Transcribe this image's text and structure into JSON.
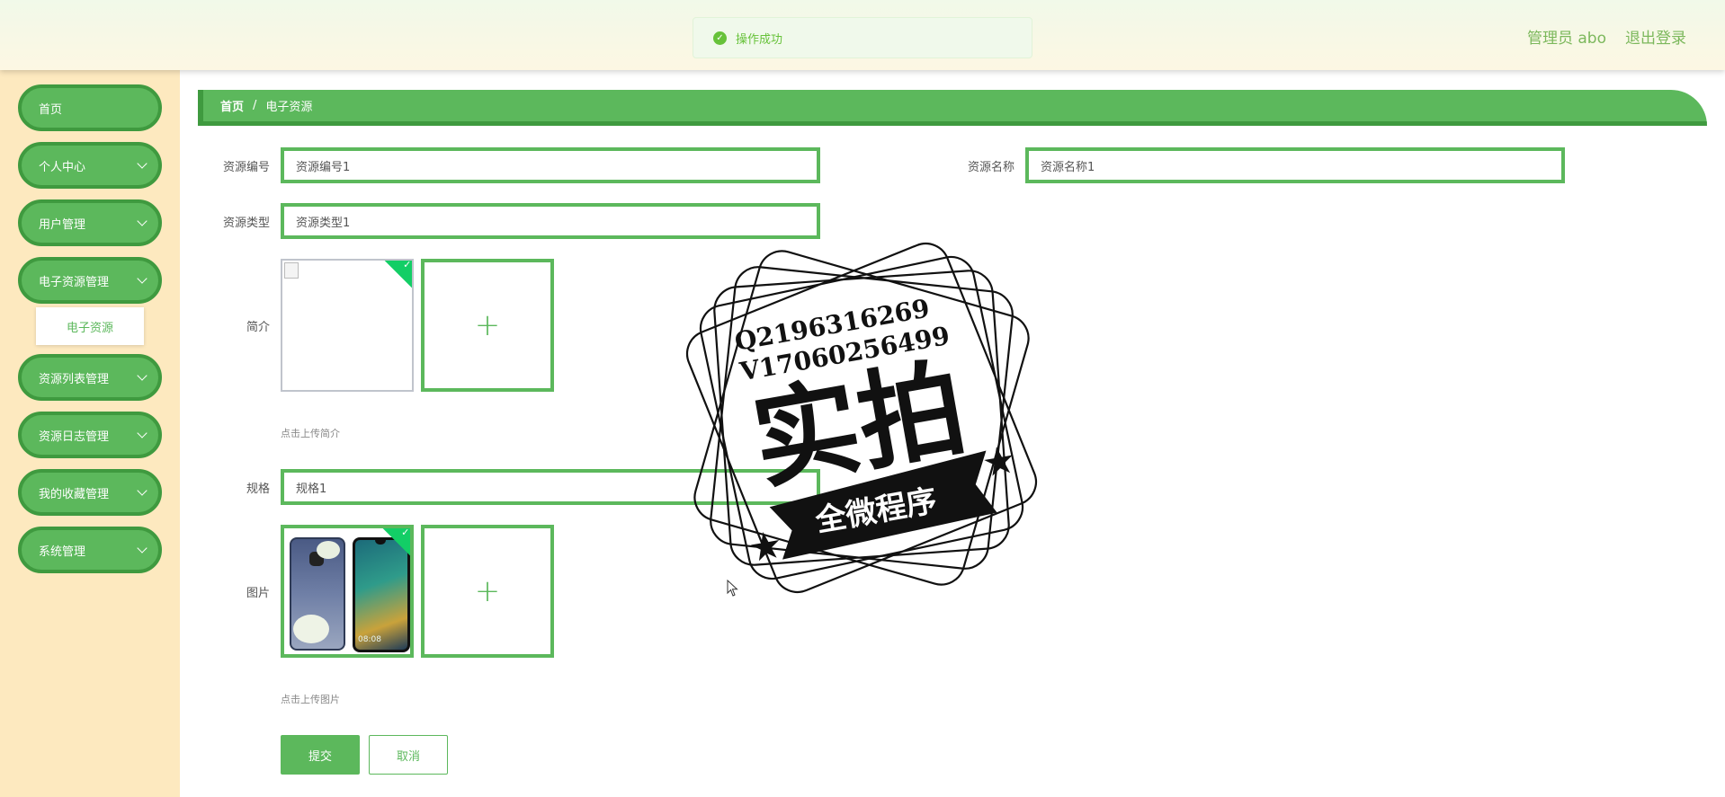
{
  "toast": {
    "message": "操作成功"
  },
  "header": {
    "user": "管理员 abo",
    "logout_label": "退出登录"
  },
  "sidebar": {
    "items": [
      {
        "label": "首页"
      },
      {
        "label": "个人中心"
      },
      {
        "label": "用户管理"
      },
      {
        "label": "电子资源管理"
      },
      {
        "label": "资源列表管理"
      },
      {
        "label": "资源日志管理"
      },
      {
        "label": "我的收藏管理"
      },
      {
        "label": "系统管理"
      }
    ],
    "sub_item": "电子资源"
  },
  "breadcrumb": {
    "home": "首页",
    "separator": "/",
    "current": "电子资源"
  },
  "form": {
    "code": {
      "label": "资源编号",
      "value": "资源编号1"
    },
    "name": {
      "label": "资源名称",
      "value": "资源名称1"
    },
    "type": {
      "label": "资源类型",
      "value": "资源类型1"
    },
    "intro": {
      "label": "简介",
      "hint": "点击上传简介"
    },
    "spec": {
      "label": "规格",
      "value": "规格1"
    },
    "image": {
      "label": "图片",
      "hint": "点击上传图片",
      "phone_time": "08:08"
    },
    "submit_label": "提交",
    "cancel_label": "取消"
  },
  "watermark": {
    "line1": "Q2196316269",
    "line2": "V17060256499",
    "big_text": "实拍",
    "ribbon_text": "全微程序"
  },
  "colors": {
    "accent": "#5cb85c",
    "accent_dark": "#3f9a3f",
    "sidebar_bg": "#fde9bf"
  }
}
